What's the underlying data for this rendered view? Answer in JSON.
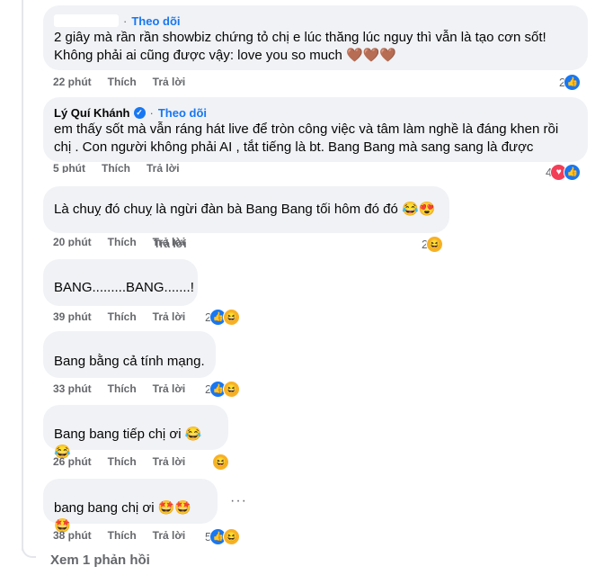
{
  "comments": [
    {
      "author": "",
      "follow": "Theo dõi",
      "text": "2 giây mà rần rần showbiz chứng tỏ chị e lúc thăng lúc nguy thì vẫn là tạo cơn sốt!\nKhông phải ai cũng được vậy: love you so much 🤎🤎🤎",
      "time": "22 phút",
      "like": "Thích",
      "reply": "Trả lời",
      "react_count": "2",
      "react_icons": [
        "like-icon"
      ]
    },
    {
      "author": "Lý Quí Khánh",
      "verified": "✓",
      "follow": "Theo dõi",
      "text": "em thấy sốt mà vẫn ráng hát live để tròn công việc và tâm làm nghề là đáng khen rồi\nchị . Con người không phải AI , tắt tiếng là bt. Bang Bang mà sang sang là được",
      "time": "5 phút",
      "like": "Thích",
      "reply": "Trả lời",
      "react_count": "4",
      "react_icons": [
        "love-icon",
        "like-icon"
      ]
    },
    {
      "text": "Là chuỵ đó chuỵ là ngừi đàn bà Bang Bang tối hôm đó đó 😂😍",
      "time": "20 phút",
      "like": "Thích",
      "reply": "Trả lời",
      "react_count": "2",
      "react_icons": [
        "haha-icon"
      ]
    },
    {
      "text": "BANG.........BANG.......!",
      "time": "39 phút",
      "like": "Thích",
      "reply": "Trả lời",
      "react_count": "2",
      "react_icons": [
        "like-icon",
        "haha-icon"
      ]
    },
    {
      "text": "Bang bằng cả tính mạng.",
      "time": "33 phút",
      "like": "Thích",
      "reply": "Trả lời",
      "react_count": "2",
      "react_icons": [
        "like-icon",
        "haha-icon"
      ]
    },
    {
      "text": "Bang bang tiếp chị ơi 😂😂",
      "time": "26 phút",
      "like": "Thích",
      "reply": "Trả lời",
      "react_count": "",
      "react_icons": [
        "haha-icon"
      ]
    },
    {
      "text": "bang bang chị ơi 🤩🤩🤩",
      "time": "38 phút",
      "like": "Thích",
      "reply": "Trả lời",
      "react_count": "5",
      "react_icons": [
        "like-icon",
        "haha-icon"
      ]
    }
  ],
  "more_options": "···",
  "see_more_replies": "Xem 1 phản hồi",
  "glyphs": {
    "like": "👍",
    "love": "♥",
    "haha": "😆"
  },
  "colors": {
    "accent": "#1877f2",
    "bubble": "#f0f2f5",
    "meta": "#65676b",
    "love": "#f33e58",
    "haha": "#f7b125"
  }
}
